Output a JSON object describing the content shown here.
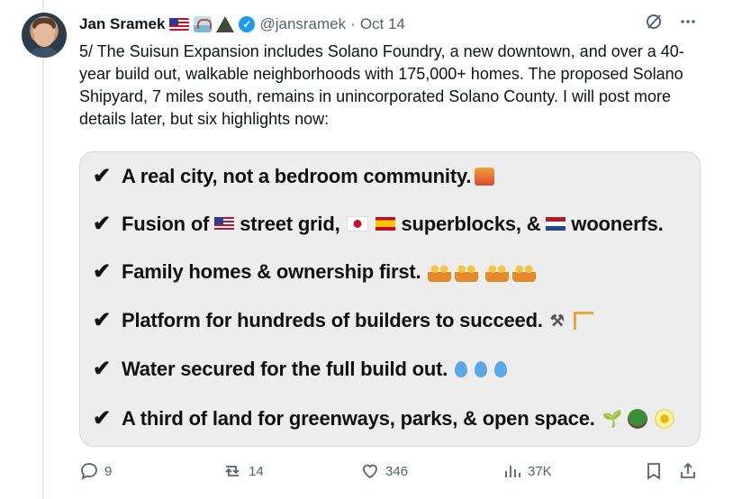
{
  "author": {
    "name": "Jan Sramek",
    "handle": "@jansramek",
    "separator": "·",
    "date": "Oct 14"
  },
  "post_text": "5/ The Suisun Expansion includes Solano Foundry, a new downtown, and over a 40-year build out, walkable neighborhoods with 175,000+ homes. The proposed Solano Shipyard, 7 miles south, remains in unincorporated Solano County. I will post more details later, but six highlights now:",
  "highlights": [
    {
      "check": "✔",
      "text_a": "A real city, not a bedroom community."
    },
    {
      "check": "✔",
      "text_a": "Fusion of",
      "text_b": "street grid,",
      "text_c": "superblocks, &",
      "text_d": "woonerfs."
    },
    {
      "check": "✔",
      "text_a": "Family homes & ownership first."
    },
    {
      "check": "✔",
      "text_a": "Platform for hundreds of builders to succeed."
    },
    {
      "check": "✔",
      "text_a": "Water secured for the full build out."
    },
    {
      "check": "✔",
      "text_a": "A third of land for greenways, parks, & open space."
    }
  ],
  "stats": {
    "replies": "9",
    "reposts": "14",
    "likes": "346",
    "views": "37K"
  },
  "icons": {
    "header": [
      "us-flag-icon",
      "bridge-icon",
      "mountain-icon",
      "verified-icon",
      "grok-icon",
      "more-icon"
    ],
    "actions": [
      "reply-icon",
      "repost-icon",
      "like-icon",
      "views-icon",
      "bookmark-icon",
      "share-icon"
    ]
  },
  "colors": {
    "accent": "#1d9bf0",
    "muted": "#536471",
    "card_bg": "#ededed"
  }
}
